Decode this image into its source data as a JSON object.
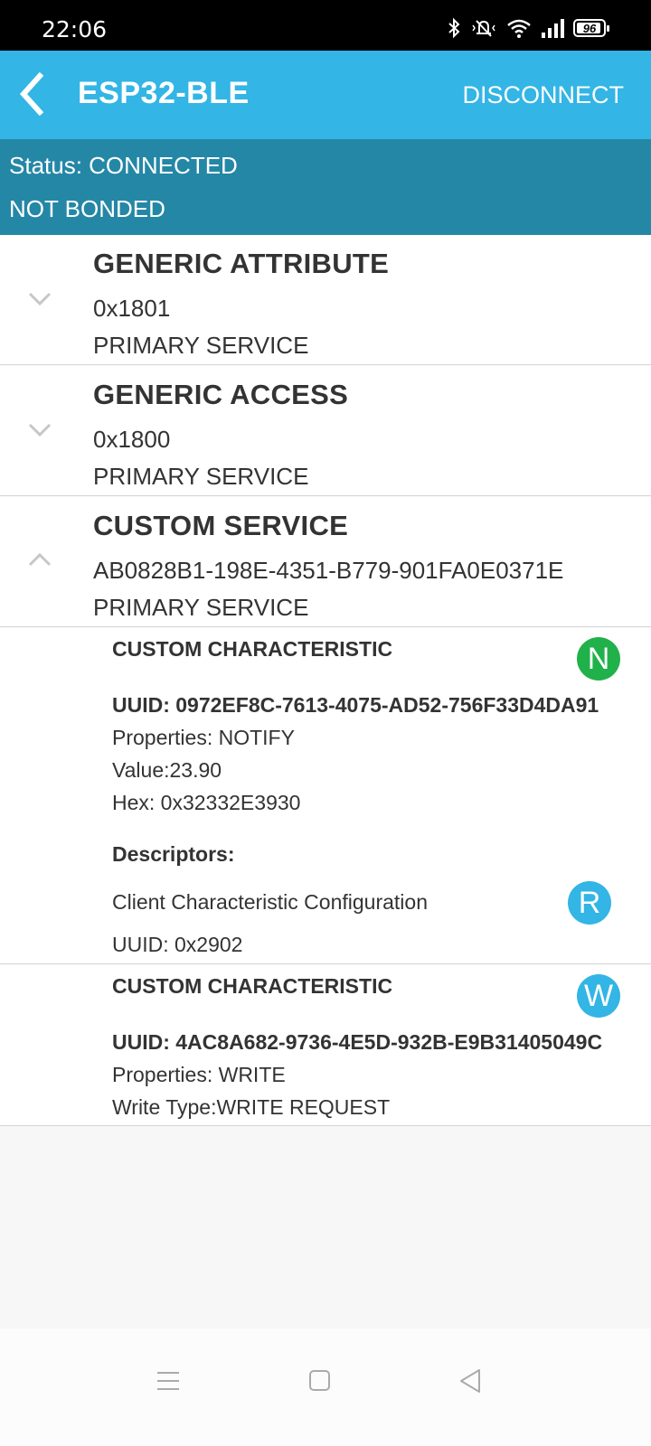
{
  "status_bar": {
    "time": "22:06",
    "battery": "96",
    "icons": [
      "bluetooth-icon",
      "mute-icon",
      "wifi-icon",
      "signal-icon",
      "battery-icon"
    ]
  },
  "app_bar": {
    "title": "ESP32-BLE",
    "action": "DISCONNECT",
    "color": "#33b5e5"
  },
  "connection": {
    "status": "Status: CONNECTED",
    "bond": "NOT BONDED",
    "color": "#2487a6"
  },
  "services": [
    {
      "name": "GENERIC ATTRIBUTE",
      "uuid": "0x1801",
      "type": "PRIMARY SERVICE",
      "expanded": false
    },
    {
      "name": "GENERIC ACCESS",
      "uuid": "0x1800",
      "type": "PRIMARY SERVICE",
      "expanded": false
    },
    {
      "name": "CUSTOM SERVICE",
      "uuid": "AB0828B1-198E-4351-B779-901FA0E0371E",
      "type": "PRIMARY SERVICE",
      "expanded": true
    }
  ],
  "characteristics": [
    {
      "name": "CUSTOM CHARACTERISTIC",
      "uuid": "UUID: 0972EF8C-7613-4075-AD52-756F33D4DA91",
      "properties": "Properties: NOTIFY",
      "value": "Value:23.90",
      "hex": "Hex: 0x32332E3930",
      "badge": "N",
      "descriptors_label": "Descriptors:",
      "descriptor": {
        "name": "Client Characteristic Configuration",
        "uuid": "UUID: 0x2902",
        "badge": "R"
      }
    },
    {
      "name": "CUSTOM CHARACTERISTIC",
      "uuid": "UUID: 4AC8A682-9736-4E5D-932B-E9B31405049C",
      "properties": "Properties: WRITE",
      "write_type": "Write Type:WRITE REQUEST",
      "badge": "W"
    }
  ],
  "nav_bar": {
    "icons": [
      "menu-icon",
      "home-icon",
      "back-icon"
    ]
  }
}
